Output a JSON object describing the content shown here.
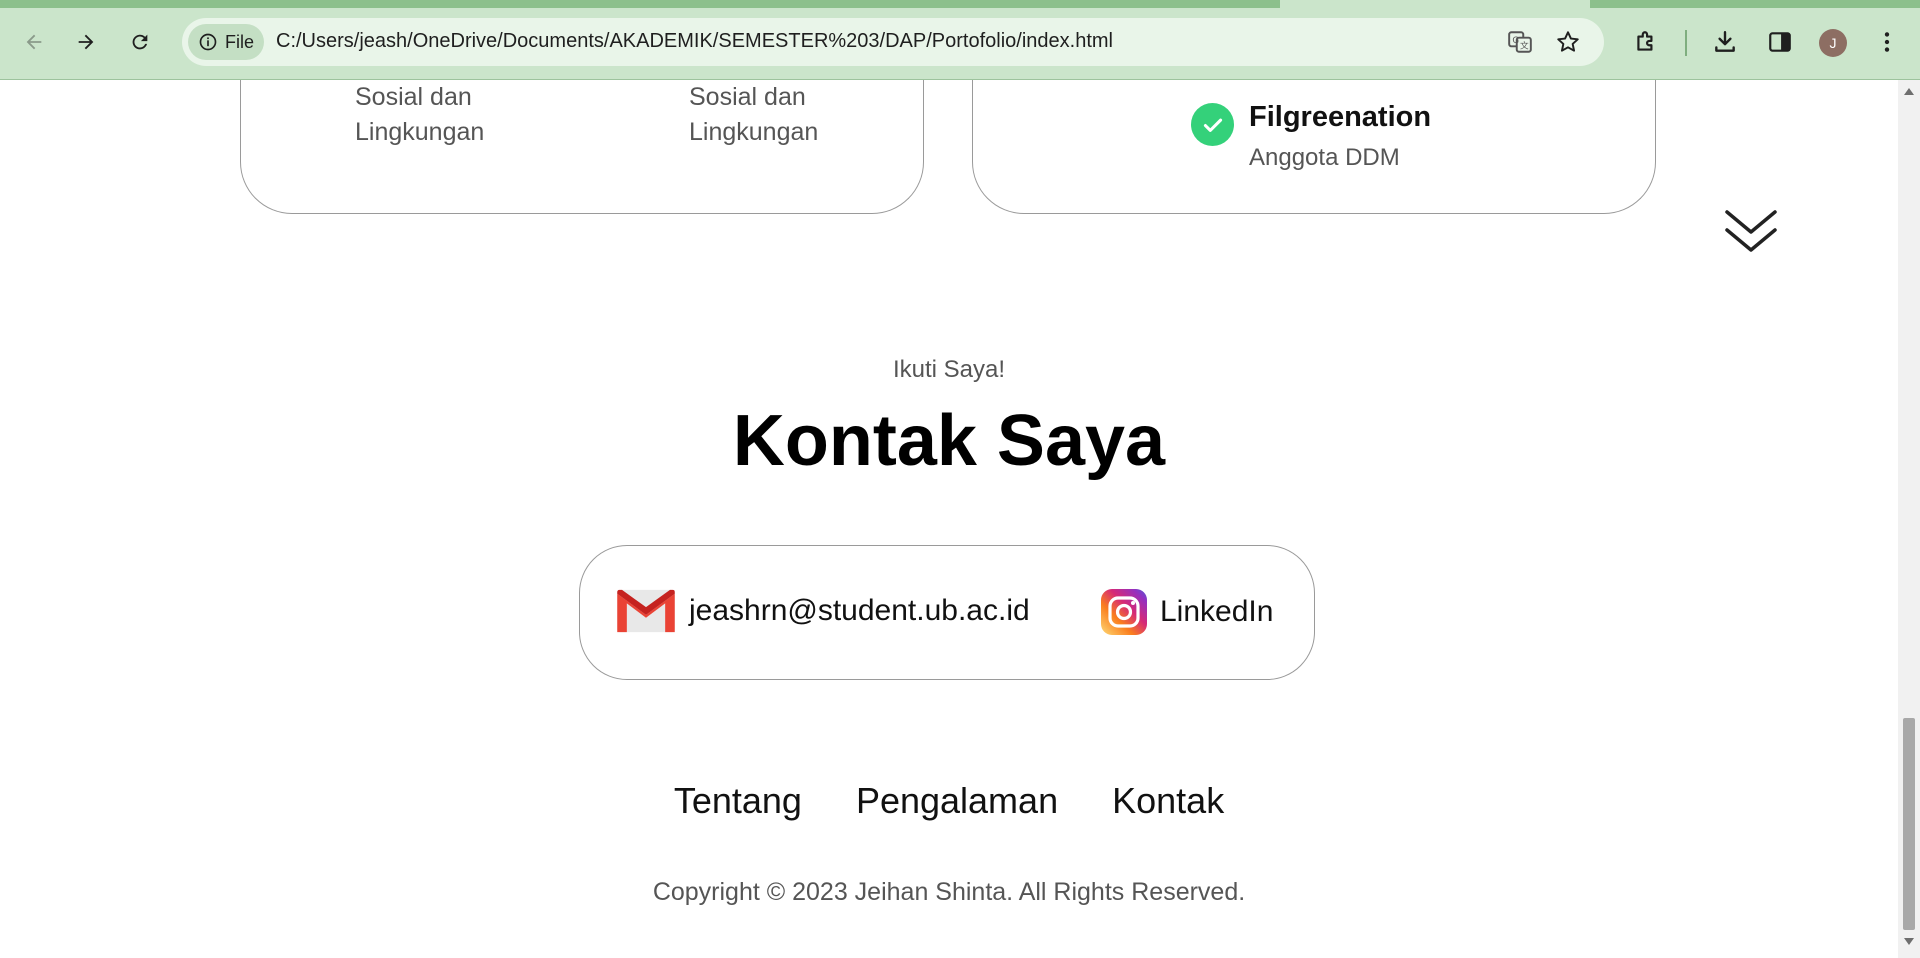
{
  "browser": {
    "site_chip_label": "File",
    "url": "C:/Users/jeash/OneDrive/Documents/AKADEMIK/SEMESTER%203/DAP/Portofolio/index.html",
    "avatar_initial": "J",
    "icons": [
      "back-icon",
      "forward-icon",
      "reload-icon",
      "info-icon",
      "translate-icon",
      "bookmark-star-icon",
      "extensions-icon",
      "download-icon",
      "side-panel-icon",
      "menu-icon"
    ]
  },
  "experience": {
    "left_card": {
      "col1_line1": "Sosial dan",
      "col1_line2": "Lingkungan",
      "col2_line1": "Sosial dan",
      "col2_line2": "Lingkungan"
    },
    "right_card": {
      "org_name": "Filgreenation",
      "org_role": "Anggota DDM",
      "check_color": "#34d17a"
    }
  },
  "contact": {
    "subtitle": "Ikuti Saya!",
    "title": "Kontak Saya",
    "email": "jeashrn@student.ub.ac.id",
    "linkedin": "LinkedIn"
  },
  "footer": {
    "nav": [
      "Tentang",
      "Pengalaman",
      "Kontak"
    ],
    "copyright": "Copyright © 2023 Jeihan Shinta. All Rights Reserved."
  },
  "colors": {
    "chrome_bg": "#cbe5cb",
    "omnibox_bg": "#e9f5e9",
    "accent_green": "#34d17a"
  }
}
